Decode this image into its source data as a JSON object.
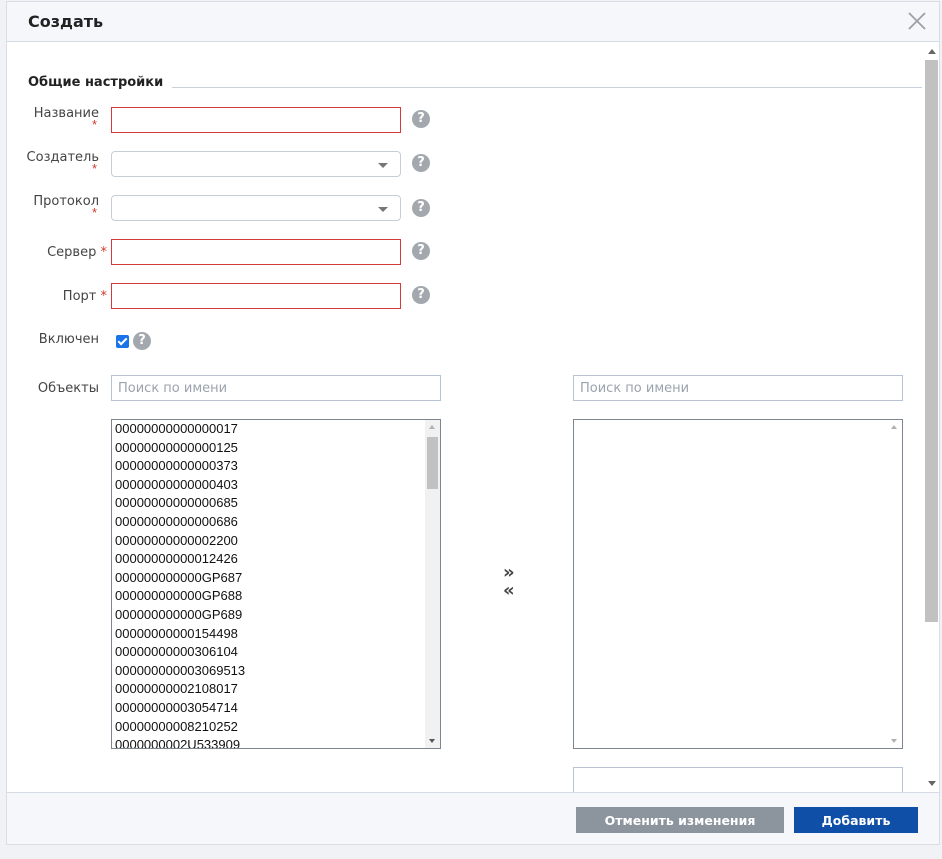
{
  "dialog": {
    "title": "Создать",
    "section_title": "Общие настройки",
    "required_mark": "*"
  },
  "fields": {
    "name": {
      "label": "Название",
      "value": ""
    },
    "creator": {
      "label": "Создатель",
      "value": ""
    },
    "protocol": {
      "label": "Протокол",
      "value": ""
    },
    "server": {
      "label": "Сервер",
      "value": ""
    },
    "port": {
      "label": "Порт",
      "value": ""
    },
    "enabled": {
      "label": "Включен",
      "checked": true
    }
  },
  "help_glyph": "?",
  "objects": {
    "label": "Объекты",
    "available_search_placeholder": "Поиск по имени",
    "selected_search_placeholder": "Поиск по имени",
    "available": [
      "00000000000000017",
      "00000000000000125",
      "00000000000000373",
      "00000000000000403",
      "00000000000000685",
      "00000000000000686",
      "00000000000002200",
      "00000000000012426",
      "000000000000GP687",
      "000000000000GP688",
      "000000000000GP689",
      "00000000000154498",
      "00000000000306104",
      "000000000003069513",
      "00000000002108017",
      "00000000003054714",
      "00000000008210252",
      "0000000002U533909"
    ],
    "selected": [],
    "move_right": "»",
    "move_left": "«"
  },
  "footer": {
    "cancel_label": "Отменить изменения",
    "add_label": "Добавить"
  },
  "colors": {
    "primary": "#0f4fa8",
    "secondary": "#8c949d",
    "error_border": "#d23b3b",
    "required": "#d0392d"
  }
}
